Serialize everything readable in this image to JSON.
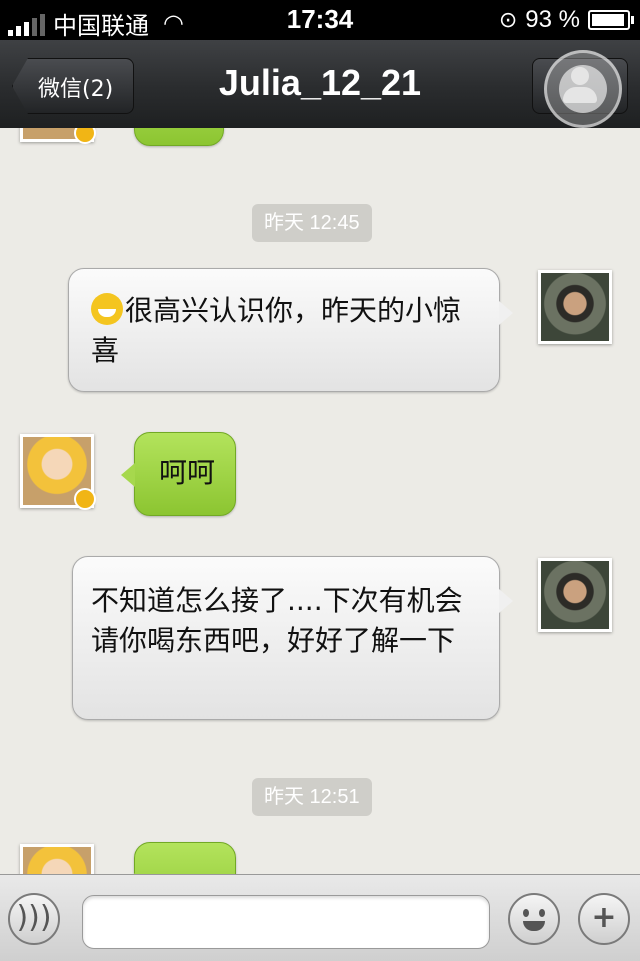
{
  "status_bar": {
    "carrier": "中国联通",
    "time": "17:34",
    "battery_percent": "93 %",
    "battery_level": 0.93
  },
  "nav": {
    "back_label": "微信(2)",
    "title": "Julia_12_21"
  },
  "chat": {
    "messages": [
      {
        "type": "timestamp",
        "text": "昨天 12:45"
      },
      {
        "type": "sent",
        "text": "很高兴认识你，昨天的小惊喜",
        "has_emoji": true
      },
      {
        "type": "received",
        "text": "呵呵"
      },
      {
        "type": "sent",
        "text": "不知道怎么接了....下次有机会请你喝东西吧，好好了解一下"
      },
      {
        "type": "timestamp",
        "text": "昨天 12:51"
      }
    ]
  },
  "input_bar": {
    "placeholder": "",
    "voice_icon": "voice-icon",
    "emoji_icon": "emoji-icon",
    "plus_icon": "plus-icon"
  },
  "colors": {
    "sent_bubble": "#efefef",
    "received_bubble": "#a6d84d",
    "nav_bg": "#2a2c2e",
    "chat_bg": "#ecebe6"
  }
}
